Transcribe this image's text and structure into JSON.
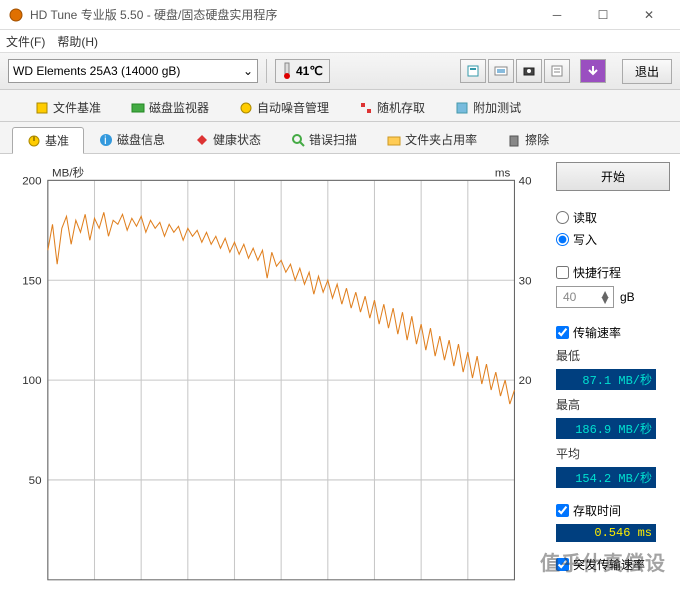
{
  "window": {
    "title": "HD Tune 专业版 5.50 - 硬盘/固态硬盘实用程序"
  },
  "menu": {
    "file": "文件(F)",
    "help": "帮助(H)"
  },
  "toolbar": {
    "drive": "WD      Elements 25A3 (14000 gB)",
    "temp": "41℃",
    "exit": "退出"
  },
  "tabs_row1": [
    {
      "label": "文件基准"
    },
    {
      "label": "磁盘监视器"
    },
    {
      "label": "自动噪音管理"
    },
    {
      "label": "随机存取"
    },
    {
      "label": "附加测试"
    }
  ],
  "tabs_row2": [
    {
      "label": "基准",
      "active": true
    },
    {
      "label": "磁盘信息"
    },
    {
      "label": "健康状态"
    },
    {
      "label": "错误扫描"
    },
    {
      "label": "文件夹占用率"
    },
    {
      "label": "擦除"
    }
  ],
  "panel": {
    "start": "开始",
    "read": "读取",
    "write": "写入",
    "shortstroke": "快捷行程",
    "shortstroke_val": "40",
    "shortstroke_unit": "gB",
    "transfer_rate": "传输速率",
    "min_label": "最低",
    "min_val": "87.1 MB/秒",
    "max_label": "最高",
    "max_val": "186.9 MB/秒",
    "avg_label": "平均",
    "avg_val": "154.2 MB/秒",
    "access_label": "存取时间",
    "access_val": "0.546 ms",
    "burst_label": "突发传输速率"
  },
  "chart_data": {
    "type": "line",
    "ylabel_left": "MB/秒",
    "ylabel_right": "ms",
    "ylim_left": [
      0,
      200
    ],
    "ylim_right": [
      0,
      40
    ],
    "yticks_left": [
      50,
      100,
      150,
      200
    ],
    "yticks_right": [
      20,
      30,
      40
    ],
    "x_range": [
      0,
      100
    ],
    "series": [
      {
        "name": "write-speed",
        "axis": "left",
        "color": "#e08020",
        "values": [
          [
            0,
            165
          ],
          [
            1,
            178
          ],
          [
            2,
            158
          ],
          [
            3,
            176
          ],
          [
            4,
            182
          ],
          [
            5,
            168
          ],
          [
            6,
            180
          ],
          [
            7,
            174
          ],
          [
            8,
            183
          ],
          [
            9,
            170
          ],
          [
            10,
            181
          ],
          [
            11,
            176
          ],
          [
            12,
            184
          ],
          [
            13,
            172
          ],
          [
            14,
            180
          ],
          [
            15,
            178
          ],
          [
            16,
            183
          ],
          [
            17,
            175
          ],
          [
            18,
            181
          ],
          [
            19,
            177
          ],
          [
            20,
            182
          ],
          [
            21,
            174
          ],
          [
            22,
            180
          ],
          [
            23,
            176
          ],
          [
            24,
            179
          ],
          [
            25,
            172
          ],
          [
            26,
            178
          ],
          [
            27,
            174
          ],
          [
            28,
            177
          ],
          [
            29,
            170
          ],
          [
            30,
            176
          ],
          [
            31,
            172
          ],
          [
            32,
            175
          ],
          [
            33,
            169
          ],
          [
            34,
            174
          ],
          [
            35,
            168
          ],
          [
            36,
            172
          ],
          [
            37,
            166
          ],
          [
            38,
            171
          ],
          [
            39,
            164
          ],
          [
            40,
            169
          ],
          [
            41,
            163
          ],
          [
            42,
            168
          ],
          [
            43,
            161
          ],
          [
            44,
            166
          ],
          [
            45,
            160
          ],
          [
            46,
            165
          ],
          [
            47,
            151
          ],
          [
            48,
            164
          ],
          [
            49,
            157
          ],
          [
            50,
            160
          ],
          [
            51,
            154
          ],
          [
            52,
            158
          ],
          [
            53,
            150
          ],
          [
            54,
            156
          ],
          [
            55,
            148
          ],
          [
            56,
            154
          ],
          [
            57,
            143
          ],
          [
            58,
            152
          ],
          [
            59,
            144
          ],
          [
            60,
            150
          ],
          [
            61,
            141
          ],
          [
            62,
            148
          ],
          [
            63,
            138
          ],
          [
            64,
            146
          ],
          [
            65,
            136
          ],
          [
            66,
            144
          ],
          [
            67,
            134
          ],
          [
            68,
            142
          ],
          [
            69,
            131
          ],
          [
            70,
            140
          ],
          [
            71,
            128
          ],
          [
            72,
            138
          ],
          [
            73,
            126
          ],
          [
            74,
            136
          ],
          [
            75,
            123
          ],
          [
            76,
            134
          ],
          [
            77,
            120
          ],
          [
            78,
            132
          ],
          [
            79,
            118
          ],
          [
            80,
            128
          ],
          [
            81,
            115
          ],
          [
            82,
            126
          ],
          [
            83,
            112
          ],
          [
            84,
            122
          ],
          [
            85,
            110
          ],
          [
            86,
            120
          ],
          [
            87,
            107
          ],
          [
            88,
            118
          ],
          [
            89,
            104
          ],
          [
            90,
            114
          ],
          [
            91,
            101
          ],
          [
            92,
            112
          ],
          [
            93,
            98
          ],
          [
            94,
            108
          ],
          [
            95,
            95
          ],
          [
            96,
            104
          ],
          [
            97,
            92
          ],
          [
            98,
            100
          ],
          [
            99,
            88
          ],
          [
            100,
            95
          ]
        ]
      }
    ]
  },
  "watermark": "值乎什真偿设"
}
